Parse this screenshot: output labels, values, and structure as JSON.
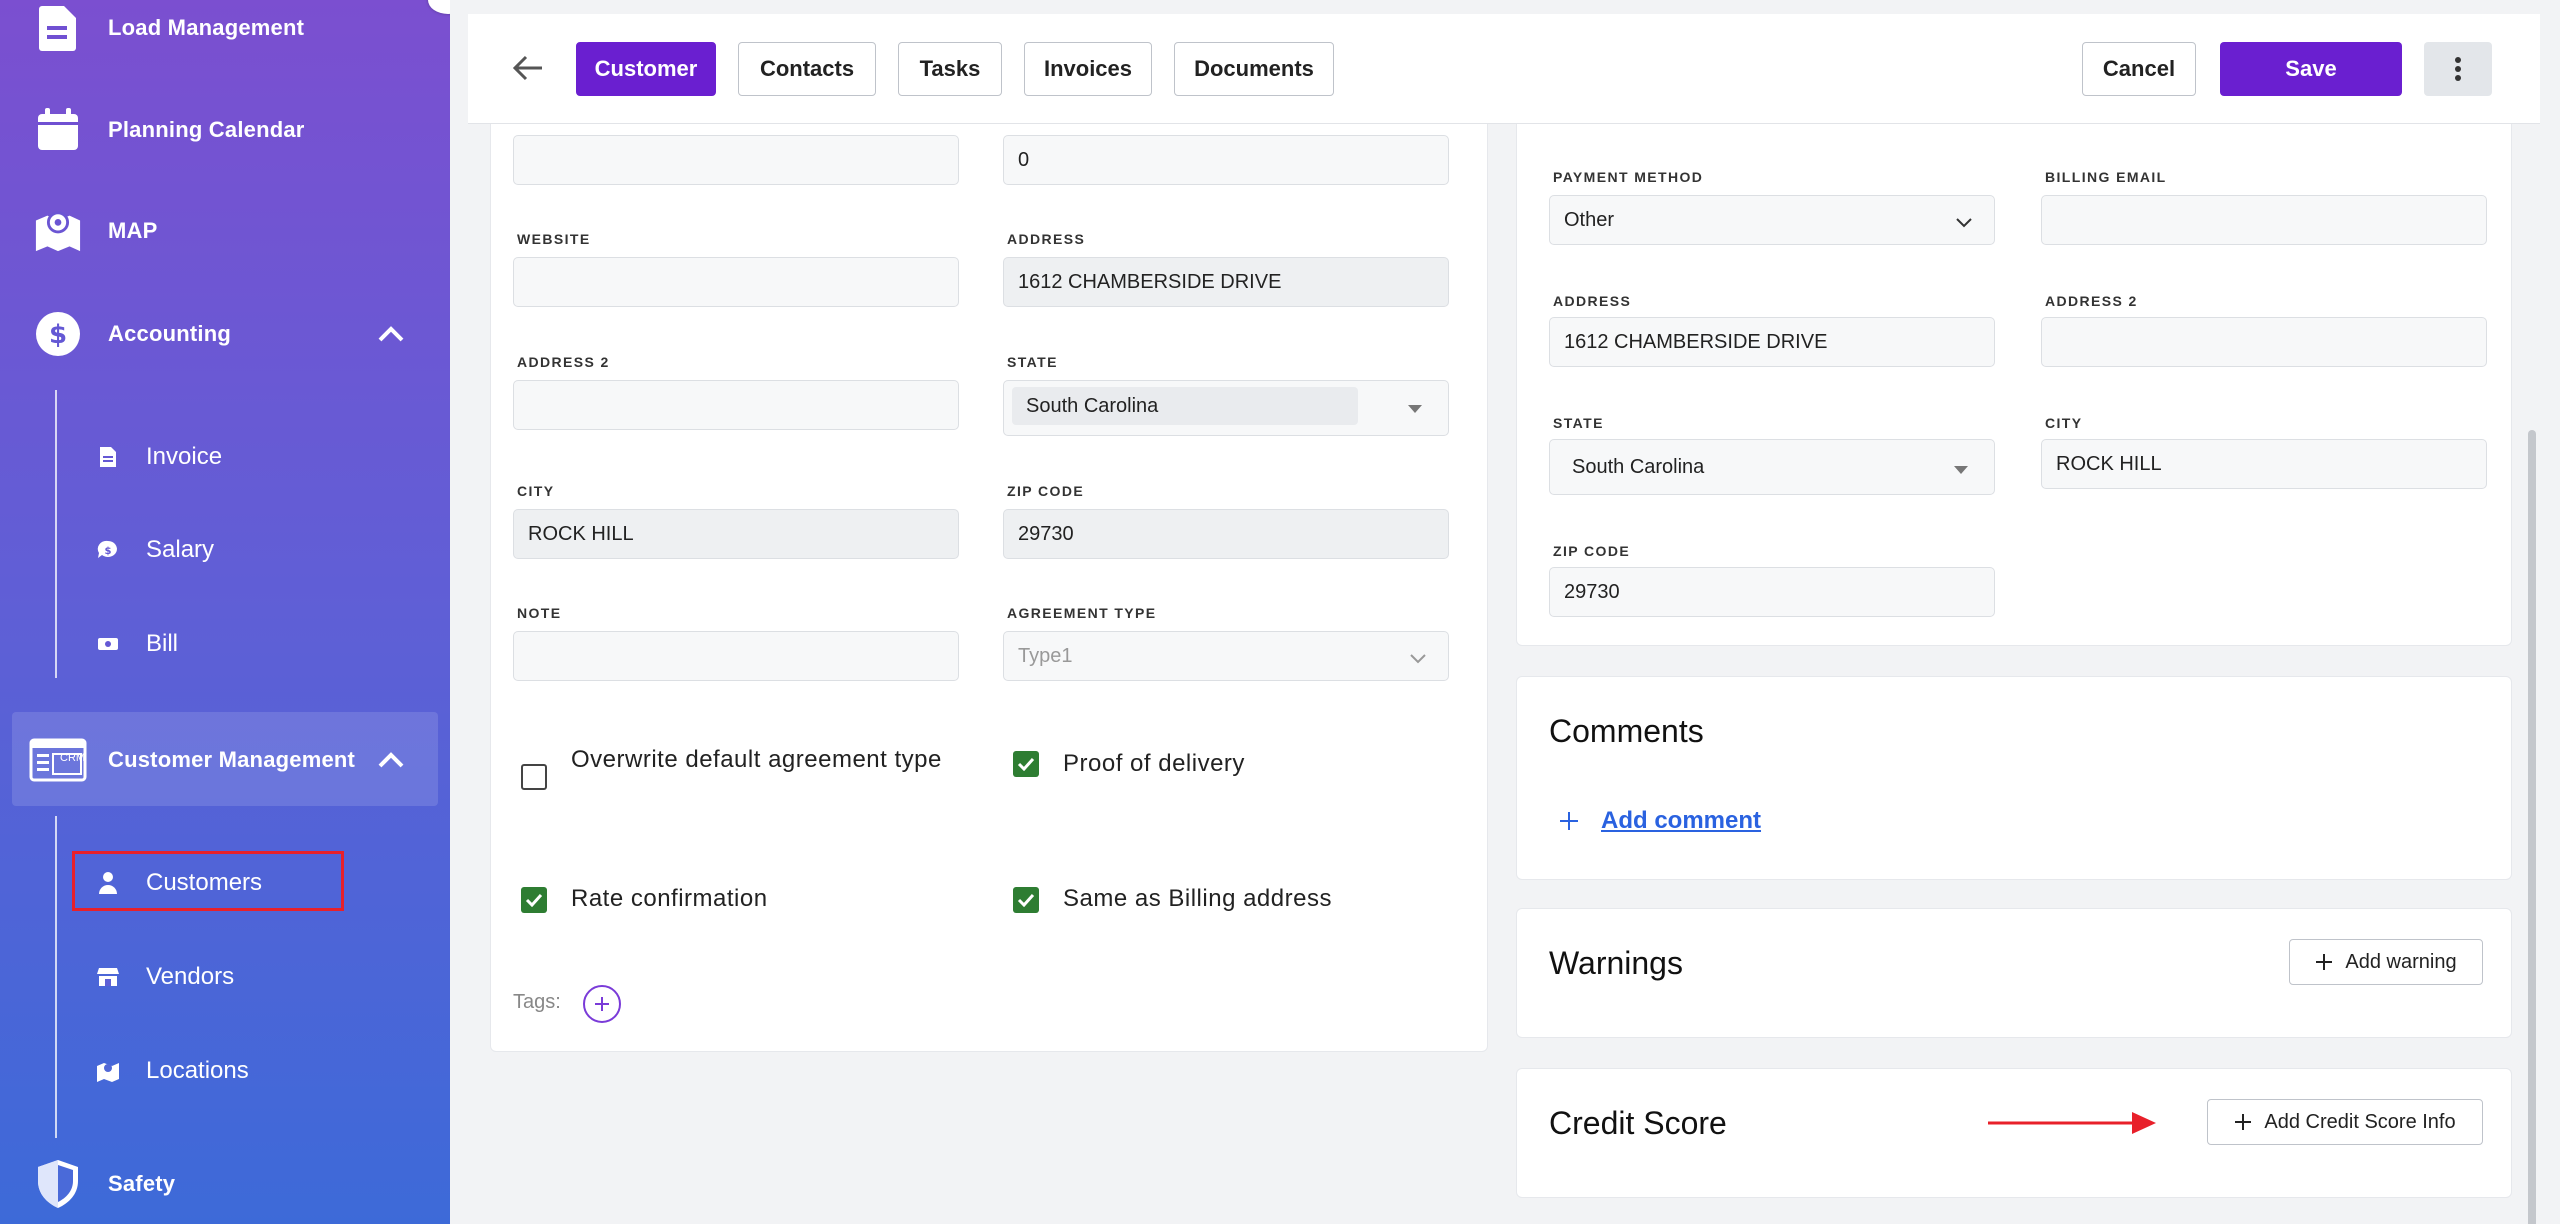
{
  "sidebar": {
    "items": [
      {
        "label": "Load Management",
        "icon": "document-icon"
      },
      {
        "label": "Planning Calendar",
        "icon": "calendar-icon"
      },
      {
        "label": "MAP",
        "icon": "map-icon"
      },
      {
        "label": "Accounting",
        "icon": "dollar-icon"
      },
      {
        "label": "Customer Management",
        "icon": "crm-icon"
      },
      {
        "label": "Safety",
        "icon": "shield-icon"
      }
    ],
    "accounting_sub": [
      {
        "label": "Invoice",
        "icon": "invoice-icon"
      },
      {
        "label": "Salary",
        "icon": "salary-icon"
      },
      {
        "label": "Bill",
        "icon": "bill-icon"
      }
    ],
    "customer_sub": [
      {
        "label": "Customers",
        "icon": "user-icon"
      },
      {
        "label": "Vendors",
        "icon": "store-icon"
      },
      {
        "label": "Locations",
        "icon": "locations-icon"
      }
    ],
    "crm_badge": "CRM"
  },
  "header": {
    "tabs": [
      "Customer",
      "Contacts",
      "Tasks",
      "Invoices",
      "Documents"
    ],
    "cancel": "Cancel",
    "save": "Save"
  },
  "left_form": {
    "field_top_left": "",
    "field_top_right": "0",
    "website_label": "WEBSITE",
    "website": "",
    "address_label": "ADDRESS",
    "address": "1612 CHAMBERSIDE DRIVE",
    "address2_label": "ADDRESS 2",
    "address2": "",
    "state_label": "STATE",
    "state": "South Carolina",
    "city_label": "CITY",
    "city": "ROCK HILL",
    "zip_label": "ZIP CODE",
    "zip": "29730",
    "note_label": "NOTE",
    "note": "",
    "agreement_label": "AGREEMENT TYPE",
    "agreement": "Type1",
    "checkboxes": {
      "overwrite": {
        "label": "Overwrite default agreement type",
        "checked": false
      },
      "proof": {
        "label": "Proof of delivery",
        "checked": true
      },
      "rate": {
        "label": "Rate confirmation",
        "checked": true
      },
      "same": {
        "label": "Same as Billing address",
        "checked": true
      }
    },
    "tags_label": "Tags:"
  },
  "billing": {
    "payment_label": "PAYMENT METHOD",
    "payment": "Other",
    "email_label": "BILLING EMAIL",
    "email": "",
    "address_label": "ADDRESS",
    "address": "1612 CHAMBERSIDE DRIVE",
    "address2_label": "ADDRESS 2",
    "address2": "",
    "state_label": "STATE",
    "state": "South Carolina",
    "city_label": "CITY",
    "city": "ROCK HILL",
    "zip_label": "ZIP CODE",
    "zip": "29730"
  },
  "comments": {
    "title": "Comments",
    "add": "Add comment"
  },
  "warnings": {
    "title": "Warnings",
    "add": "Add warning"
  },
  "credit": {
    "title": "Credit Score",
    "add": "Add Credit Score Info"
  },
  "colors": {
    "accent": "#6a1fd0",
    "check": "#2e7d32",
    "link": "#2a62e0",
    "annotation": "#e8202a"
  }
}
